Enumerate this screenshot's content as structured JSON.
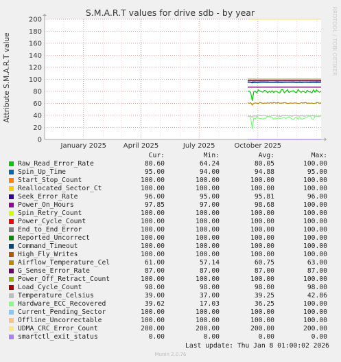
{
  "chart_data": {
    "type": "line",
    "title": "S.M.A.R.T values for drive sdb - by year",
    "ylabel": "Attribute S.M.A.R.T value",
    "ylim": [
      0,
      200
    ],
    "yticks": [
      0,
      20,
      40,
      60,
      80,
      100,
      120,
      140,
      160,
      180,
      200
    ],
    "x_domain": [
      "2024-11-01",
      "2026-01-08"
    ],
    "xticks": [
      {
        "date": "2025-01-01",
        "label": "January 2025"
      },
      {
        "date": "2025-04-01",
        "label": "April 2025"
      },
      {
        "date": "2025-07-01",
        "label": "July 2025"
      },
      {
        "date": "2025-10-01",
        "label": "October 2025"
      }
    ],
    "data_start": "2025-09-15",
    "grid": true,
    "side_label": "RRDTOOL / TOBI OETIKER",
    "columns": [
      "Cur:",
      "Min:",
      "Avg:",
      "Max:"
    ],
    "series": [
      {
        "name": "Raw_Read_Error_Rate",
        "color": "#00cc00",
        "cur": "80.60",
        "min": "64.24",
        "avg": "80.05",
        "max": "100.00"
      },
      {
        "name": "Spin_Up_Time",
        "color": "#0066b3",
        "cur": "95.00",
        "min": "94.00",
        "avg": "94.88",
        "max": "95.00"
      },
      {
        "name": "Start_Stop_Count",
        "color": "#ff8000",
        "cur": "100.00",
        "min": "100.00",
        "avg": "100.00",
        "max": "100.00"
      },
      {
        "name": "Reallocated_Sector_Ct",
        "color": "#ffcc00",
        "cur": "100.00",
        "min": "100.00",
        "avg": "100.00",
        "max": "100.00"
      },
      {
        "name": "Seek_Error_Rate",
        "color": "#330099",
        "cur": "96.00",
        "min": "95.00",
        "avg": "95.81",
        "max": "96.00"
      },
      {
        "name": "Power_On_Hours",
        "color": "#990099",
        "cur": "97.85",
        "min": "97.00",
        "avg": "98.68",
        "max": "100.00"
      },
      {
        "name": "Spin_Retry_Count",
        "color": "#ccff00",
        "cur": "100.00",
        "min": "100.00",
        "avg": "100.00",
        "max": "100.00"
      },
      {
        "name": "Power_Cycle_Count",
        "color": "#ff0000",
        "cur": "100.00",
        "min": "100.00",
        "avg": "100.00",
        "max": "100.00"
      },
      {
        "name": "End_to_End_Error",
        "color": "#808080",
        "cur": "100.00",
        "min": "100.00",
        "avg": "100.00",
        "max": "100.00"
      },
      {
        "name": "Reported_Uncorrect",
        "color": "#008f00",
        "cur": "100.00",
        "min": "100.00",
        "avg": "100.00",
        "max": "100.00"
      },
      {
        "name": "Command_Timeout",
        "color": "#00487d",
        "cur": "100.00",
        "min": "100.00",
        "avg": "100.00",
        "max": "100.00"
      },
      {
        "name": "High_Fly_Writes",
        "color": "#b35a00",
        "cur": "100.00",
        "min": "100.00",
        "avg": "100.00",
        "max": "100.00"
      },
      {
        "name": "Airflow_Temperature_Cel",
        "color": "#b38f00",
        "cur": "61.00",
        "min": "57.14",
        "avg": "60.75",
        "max": "63.00"
      },
      {
        "name": "G_Sense_Error_Rate",
        "color": "#6b006b",
        "cur": "87.00",
        "min": "87.00",
        "avg": "87.00",
        "max": "87.00"
      },
      {
        "name": "Power_Off_Retract_Count",
        "color": "#8fb300",
        "cur": "100.00",
        "min": "100.00",
        "avg": "100.00",
        "max": "100.00"
      },
      {
        "name": "Load_Cycle_Count",
        "color": "#b30000",
        "cur": "98.00",
        "min": "98.00",
        "avg": "98.00",
        "max": "98.00"
      },
      {
        "name": "Temperature_Celsius",
        "color": "#bebebe",
        "cur": "39.00",
        "min": "37.00",
        "avg": "39.25",
        "max": "42.86"
      },
      {
        "name": "Hardware_ECC_Recovered",
        "color": "#80ff80",
        "cur": "39.62",
        "min": "17.03",
        "avg": "36.25",
        "max": "100.00"
      },
      {
        "name": "Current_Pending_Sector",
        "color": "#80c9ff",
        "cur": "100.00",
        "min": "100.00",
        "avg": "100.00",
        "max": "100.00"
      },
      {
        "name": "Offline_Uncorrectable",
        "color": "#ffc080",
        "cur": "100.00",
        "min": "100.00",
        "avg": "100.00",
        "max": "100.00"
      },
      {
        "name": "UDMA_CRC_Error_Count",
        "color": "#ffe680",
        "cur": "200.00",
        "min": "200.00",
        "avg": "200.00",
        "max": "200.00"
      },
      {
        "name": "smartctl_exit_status",
        "color": "#aa80ff",
        "cur": "0.00",
        "min": "0.00",
        "avg": "0.00",
        "max": "0.00"
      }
    ]
  },
  "last_update": "Last update: Thu Jan  8 01:00:02 2026",
  "munin_version": "Munin 2.0.76"
}
